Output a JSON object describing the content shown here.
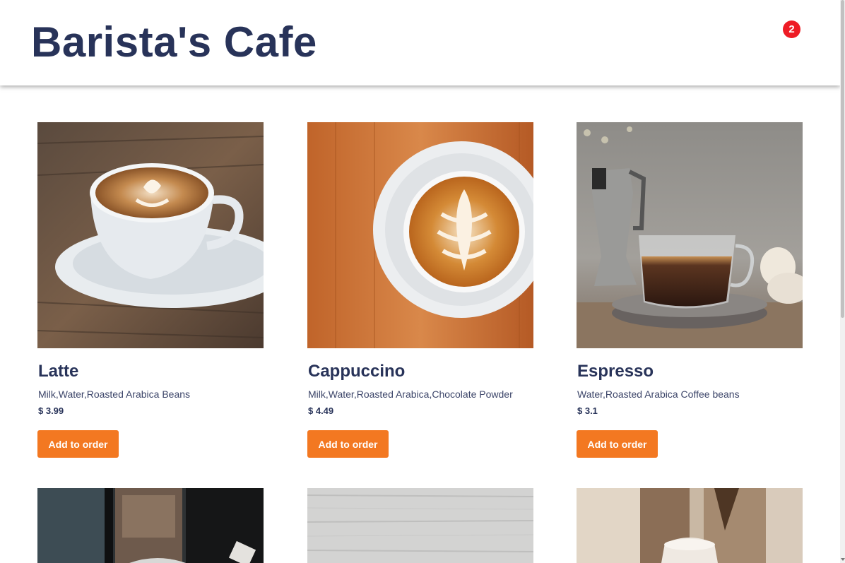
{
  "header": {
    "title": "Barista's Cafe",
    "cart_icon": "shopping-cart-icon",
    "cart_count": "2"
  },
  "colors": {
    "brand": "#283359",
    "button": "#f37821",
    "badge": "#ee1c25"
  },
  "products": [
    {
      "name": "Latte",
      "ingredients": "Milk,Water,Roasted Arabica Beans",
      "price": "$ 3.99",
      "button_label": "Add to order",
      "image": "latte-cup-on-saucer"
    },
    {
      "name": "Cappuccino",
      "ingredients": "Milk,Water,Roasted Arabica,Chocolate Powder",
      "price": "$ 4.49",
      "button_label": "Add to order",
      "image": "cappuccino-top-view"
    },
    {
      "name": "Espresso",
      "ingredients": "Water,Roasted Arabica Coffee beans",
      "price": "$ 3.1",
      "button_label": "Add to order",
      "image": "espresso-glass-with-moka-pot"
    }
  ],
  "partial_products": [
    {
      "image": "dark-cafe-photo"
    },
    {
      "image": "grey-wood-photo"
    },
    {
      "image": "iced-coffee-photo"
    }
  ]
}
